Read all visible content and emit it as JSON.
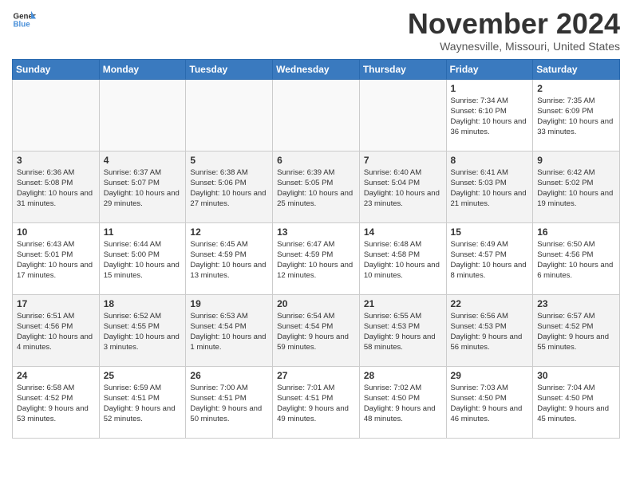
{
  "header": {
    "logo_general": "General",
    "logo_blue": "Blue",
    "month_title": "November 2024",
    "location": "Waynesville, Missouri, United States"
  },
  "calendar": {
    "weekdays": [
      "Sunday",
      "Monday",
      "Tuesday",
      "Wednesday",
      "Thursday",
      "Friday",
      "Saturday"
    ],
    "weeks": [
      [
        {
          "day": "",
          "info": ""
        },
        {
          "day": "",
          "info": ""
        },
        {
          "day": "",
          "info": ""
        },
        {
          "day": "",
          "info": ""
        },
        {
          "day": "",
          "info": ""
        },
        {
          "day": "1",
          "info": "Sunrise: 7:34 AM\nSunset: 6:10 PM\nDaylight: 10 hours and 36 minutes."
        },
        {
          "day": "2",
          "info": "Sunrise: 7:35 AM\nSunset: 6:09 PM\nDaylight: 10 hours and 33 minutes."
        }
      ],
      [
        {
          "day": "3",
          "info": "Sunrise: 6:36 AM\nSunset: 5:08 PM\nDaylight: 10 hours and 31 minutes."
        },
        {
          "day": "4",
          "info": "Sunrise: 6:37 AM\nSunset: 5:07 PM\nDaylight: 10 hours and 29 minutes."
        },
        {
          "day": "5",
          "info": "Sunrise: 6:38 AM\nSunset: 5:06 PM\nDaylight: 10 hours and 27 minutes."
        },
        {
          "day": "6",
          "info": "Sunrise: 6:39 AM\nSunset: 5:05 PM\nDaylight: 10 hours and 25 minutes."
        },
        {
          "day": "7",
          "info": "Sunrise: 6:40 AM\nSunset: 5:04 PM\nDaylight: 10 hours and 23 minutes."
        },
        {
          "day": "8",
          "info": "Sunrise: 6:41 AM\nSunset: 5:03 PM\nDaylight: 10 hours and 21 minutes."
        },
        {
          "day": "9",
          "info": "Sunrise: 6:42 AM\nSunset: 5:02 PM\nDaylight: 10 hours and 19 minutes."
        }
      ],
      [
        {
          "day": "10",
          "info": "Sunrise: 6:43 AM\nSunset: 5:01 PM\nDaylight: 10 hours and 17 minutes."
        },
        {
          "day": "11",
          "info": "Sunrise: 6:44 AM\nSunset: 5:00 PM\nDaylight: 10 hours and 15 minutes."
        },
        {
          "day": "12",
          "info": "Sunrise: 6:45 AM\nSunset: 4:59 PM\nDaylight: 10 hours and 13 minutes."
        },
        {
          "day": "13",
          "info": "Sunrise: 6:47 AM\nSunset: 4:59 PM\nDaylight: 10 hours and 12 minutes."
        },
        {
          "day": "14",
          "info": "Sunrise: 6:48 AM\nSunset: 4:58 PM\nDaylight: 10 hours and 10 minutes."
        },
        {
          "day": "15",
          "info": "Sunrise: 6:49 AM\nSunset: 4:57 PM\nDaylight: 10 hours and 8 minutes."
        },
        {
          "day": "16",
          "info": "Sunrise: 6:50 AM\nSunset: 4:56 PM\nDaylight: 10 hours and 6 minutes."
        }
      ],
      [
        {
          "day": "17",
          "info": "Sunrise: 6:51 AM\nSunset: 4:56 PM\nDaylight: 10 hours and 4 minutes."
        },
        {
          "day": "18",
          "info": "Sunrise: 6:52 AM\nSunset: 4:55 PM\nDaylight: 10 hours and 3 minutes."
        },
        {
          "day": "19",
          "info": "Sunrise: 6:53 AM\nSunset: 4:54 PM\nDaylight: 10 hours and 1 minute."
        },
        {
          "day": "20",
          "info": "Sunrise: 6:54 AM\nSunset: 4:54 PM\nDaylight: 9 hours and 59 minutes."
        },
        {
          "day": "21",
          "info": "Sunrise: 6:55 AM\nSunset: 4:53 PM\nDaylight: 9 hours and 58 minutes."
        },
        {
          "day": "22",
          "info": "Sunrise: 6:56 AM\nSunset: 4:53 PM\nDaylight: 9 hours and 56 minutes."
        },
        {
          "day": "23",
          "info": "Sunrise: 6:57 AM\nSunset: 4:52 PM\nDaylight: 9 hours and 55 minutes."
        }
      ],
      [
        {
          "day": "24",
          "info": "Sunrise: 6:58 AM\nSunset: 4:52 PM\nDaylight: 9 hours and 53 minutes."
        },
        {
          "day": "25",
          "info": "Sunrise: 6:59 AM\nSunset: 4:51 PM\nDaylight: 9 hours and 52 minutes."
        },
        {
          "day": "26",
          "info": "Sunrise: 7:00 AM\nSunset: 4:51 PM\nDaylight: 9 hours and 50 minutes."
        },
        {
          "day": "27",
          "info": "Sunrise: 7:01 AM\nSunset: 4:51 PM\nDaylight: 9 hours and 49 minutes."
        },
        {
          "day": "28",
          "info": "Sunrise: 7:02 AM\nSunset: 4:50 PM\nDaylight: 9 hours and 48 minutes."
        },
        {
          "day": "29",
          "info": "Sunrise: 7:03 AM\nSunset: 4:50 PM\nDaylight: 9 hours and 46 minutes."
        },
        {
          "day": "30",
          "info": "Sunrise: 7:04 AM\nSunset: 4:50 PM\nDaylight: 9 hours and 45 minutes."
        }
      ]
    ]
  }
}
